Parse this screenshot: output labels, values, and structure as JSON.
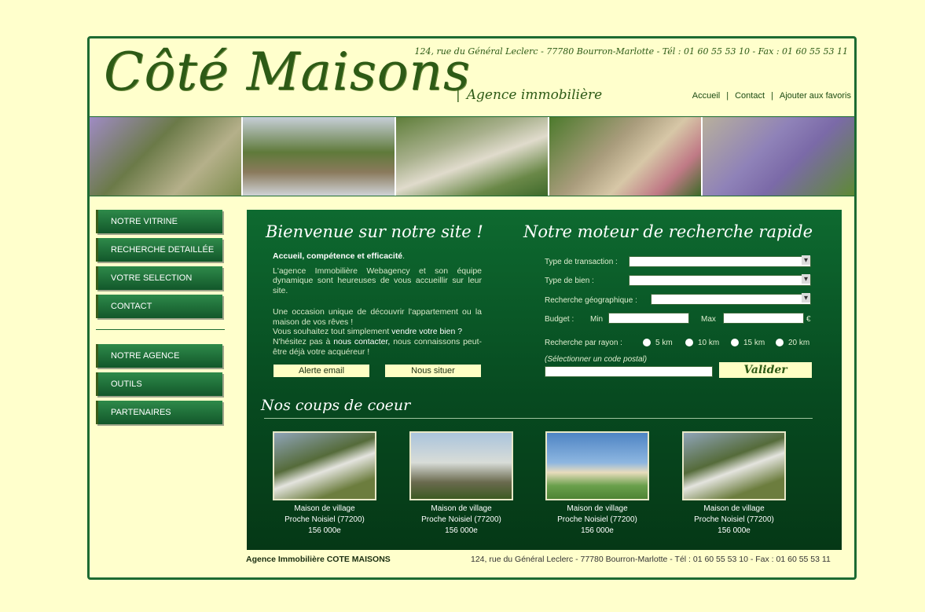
{
  "header": {
    "logo": "Côté Maisons",
    "tagline": "Agence immobilière",
    "address": "124, rue du Général Leclerc - 77780 Bourron-Marlotte - Tél : 01 60 55 53 10 - Fax : 01 60 55 53 11",
    "links": [
      "Accueil",
      "Contact",
      "Ajouter aux favoris"
    ],
    "separator": "|"
  },
  "menu": {
    "top": [
      "NOTRE VITRINE",
      "RECHERCHE DETAILLÉE",
      "VOTRE SELECTION",
      "CONTACT"
    ],
    "bottom": [
      "NOTRE AGENCE",
      "OUTILS",
      "PARTENAIRES"
    ]
  },
  "welcome": {
    "title": "Bienvenue sur notre site !",
    "lead": "Accueil, compétence et efficacité",
    "p1": "L'agence Immobilière Webagency et son équipe dynamique sont heureuses de vous accueillir sur leur site.",
    "p2": "Une occasion unique de découvrir l'appartement ou la maison de vos rêves !",
    "p3a": "Vous souhaitez tout simplement ",
    "p3b": "vendre votre bien ?",
    "p4a": "N'hésitez pas à ",
    "p4b": "nous contacter,",
    "p4c": " nous connaissons peut-être déjà votre acquéreur !",
    "btn_alert": "Alerte email",
    "btn_locate": "Nous situer"
  },
  "search": {
    "title": "Notre moteur de recherche rapide",
    "transaction_label": "Type de transaction :",
    "bien_label": "Type de bien :",
    "geo_label": "Recherche géographique :",
    "budget_label": "Budget :",
    "min_label": "Min",
    "max_label": "Max",
    "currency": "€",
    "rayon_label": "Recherche par rayon :",
    "radius_options": [
      "5 km",
      "10 km",
      "15 km",
      "20 km"
    ],
    "postal_hint": "(Sélectionner un code postal)",
    "submit": "Valider"
  },
  "favorites": {
    "title": "Nos coups de coeur",
    "items": [
      {
        "type": "Maison de village",
        "location": "Proche Noisiel (77200)",
        "price": "156 000e"
      },
      {
        "type": "Maison de village",
        "location": "Proche Noisiel (77200)",
        "price": "156 000e"
      },
      {
        "type": "Maison de village",
        "location": "Proche Noisiel (77200)",
        "price": "156 000e"
      },
      {
        "type": "Maison de village",
        "location": "Proche Noisiel (77200)",
        "price": "156 000e"
      }
    ]
  },
  "footer": {
    "agency": "Agence Immobilière COTE MAISONS",
    "address": "124, rue du Général Leclerc - 77780 Bourron-Marlotte - Tél : 01 60 55 53 10 - Fax : 01 60 55 53 11"
  },
  "colors": {
    "background": "#ffffcc",
    "frame": "#1d6b32",
    "main_panel": "#0e6a30",
    "button_light": "#ffffc4"
  }
}
